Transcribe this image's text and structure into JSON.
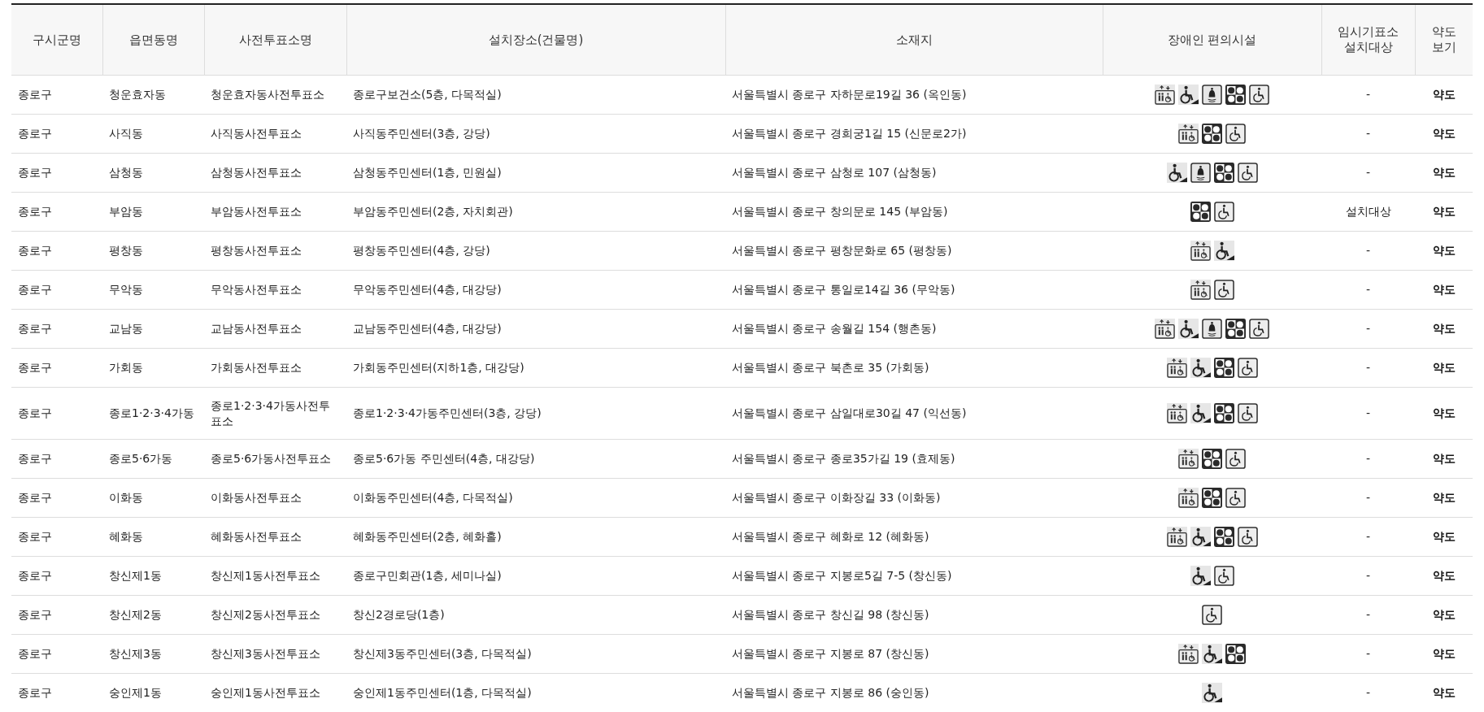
{
  "columns": [
    "구시군명",
    "읍면동명",
    "사전투표소명",
    "설치장소(건물명)",
    "소재지",
    "장애인 편의시설",
    "임시기표소 설치대상",
    "약도 보기"
  ],
  "rows": [
    {
      "district": "종로구",
      "dong": "청운효자동",
      "station": "청운효자동사전투표소",
      "place": "종로구보건소(5층, 다목적실)",
      "address": "서울특별시 종로구 자하문로19길 36 (옥인동)",
      "facilities": [
        {
          "kind": "elevator"
        },
        {
          "kind": "ramp"
        },
        {
          "kind": "bell"
        },
        {
          "kind": "braille"
        },
        {
          "kind": "wheelchair"
        }
      ],
      "temp_booth": "-",
      "map_link": "약도"
    },
    {
      "district": "종로구",
      "dong": "사직동",
      "station": "사직동사전투표소",
      "place": "사직동주민센터(3층, 강당)",
      "address": "서울특별시 종로구 경희궁1길 15 (신문로2가)",
      "facilities": [
        {
          "kind": "elevator"
        },
        {
          "kind": "braille"
        },
        {
          "kind": "wheelchair"
        }
      ],
      "temp_booth": "-",
      "map_link": "약도"
    },
    {
      "district": "종로구",
      "dong": "삼청동",
      "station": "삼청동사전투표소",
      "place": "삼청동주민센터(1층, 민원실)",
      "address": "서울특별시 종로구 삼청로 107 (삼청동)",
      "facilities": [
        {
          "kind": "ramp"
        },
        {
          "kind": "bell"
        },
        {
          "kind": "braille"
        },
        {
          "kind": "wheelchair"
        }
      ],
      "temp_booth": "-",
      "map_link": "약도"
    },
    {
      "district": "종로구",
      "dong": "부암동",
      "station": "부암동사전투표소",
      "place": "부암동주민센터(2층, 자치회관)",
      "address": "서울특별시 종로구 창의문로 145 (부암동)",
      "facilities": [
        {
          "kind": "braille"
        },
        {
          "kind": "wheelchair"
        }
      ],
      "temp_booth": "설치대상",
      "map_link": "약도"
    },
    {
      "district": "종로구",
      "dong": "평창동",
      "station": "평창동사전투표소",
      "place": "평창동주민센터(4층, 강당)",
      "address": "서울특별시 종로구 평창문화로 65 (평창동)",
      "facilities": [
        {
          "kind": "elevator"
        },
        {
          "kind": "ramp"
        }
      ],
      "temp_booth": "-",
      "map_link": "약도"
    },
    {
      "district": "종로구",
      "dong": "무악동",
      "station": "무악동사전투표소",
      "place": "무악동주민센터(4층, 대강당)",
      "address": "서울특별시 종로구 통일로14길 36 (무악동)",
      "facilities": [
        {
          "kind": "elevator"
        },
        {
          "kind": "wheelchair"
        }
      ],
      "temp_booth": "-",
      "map_link": "약도"
    },
    {
      "district": "종로구",
      "dong": "교남동",
      "station": "교남동사전투표소",
      "place": "교남동주민센터(4층, 대강당)",
      "address": "서울특별시 종로구 송월길 154 (행촌동)",
      "facilities": [
        {
          "kind": "elevator"
        },
        {
          "kind": "ramp"
        },
        {
          "kind": "bell"
        },
        {
          "kind": "braille"
        },
        {
          "kind": "wheelchair"
        }
      ],
      "temp_booth": "-",
      "map_link": "약도"
    },
    {
      "district": "종로구",
      "dong": "가회동",
      "station": "가회동사전투표소",
      "place": "가회동주민센터(지하1층, 대강당)",
      "address": "서울특별시 종로구 북촌로 35 (가회동)",
      "facilities": [
        {
          "kind": "elevator"
        },
        {
          "kind": "ramp"
        },
        {
          "kind": "braille"
        },
        {
          "kind": "wheelchair"
        }
      ],
      "temp_booth": "-",
      "map_link": "약도"
    },
    {
      "district": "종로구",
      "dong": "종로1·2·3·4가동",
      "station": "종로1·2·3·4가동사전투표소",
      "place": "종로1·2·3·4가동주민센터(3층, 강당)",
      "address": "서울특별시 종로구 삼일대로30길 47 (익선동)",
      "facilities": [
        {
          "kind": "elevator"
        },
        {
          "kind": "ramp"
        },
        {
          "kind": "braille"
        },
        {
          "kind": "wheelchair"
        }
      ],
      "temp_booth": "-",
      "map_link": "약도"
    },
    {
      "district": "종로구",
      "dong": "종로5·6가동",
      "station": "종로5·6가동사전투표소",
      "place": "종로5·6가동 주민센터(4층, 대강당)",
      "address": "서울특별시 종로구 종로35가길 19 (효제동)",
      "facilities": [
        {
          "kind": "elevator"
        },
        {
          "kind": "braille"
        },
        {
          "kind": "wheelchair"
        }
      ],
      "temp_booth": "-",
      "map_link": "약도"
    },
    {
      "district": "종로구",
      "dong": "이화동",
      "station": "이화동사전투표소",
      "place": "이화동주민센터(4층, 다목적실)",
      "address": "서울특별시 종로구 이화장길 33 (이화동)",
      "facilities": [
        {
          "kind": "elevator"
        },
        {
          "kind": "braille"
        },
        {
          "kind": "wheelchair"
        }
      ],
      "temp_booth": "-",
      "map_link": "약도"
    },
    {
      "district": "종로구",
      "dong": "혜화동",
      "station": "혜화동사전투표소",
      "place": "혜화동주민센터(2층, 혜화홀)",
      "address": "서울특별시 종로구 혜화로 12 (혜화동)",
      "facilities": [
        {
          "kind": "elevator"
        },
        {
          "kind": "ramp"
        },
        {
          "kind": "braille"
        },
        {
          "kind": "wheelchair"
        }
      ],
      "temp_booth": "-",
      "map_link": "약도"
    },
    {
      "district": "종로구",
      "dong": "창신제1동",
      "station": "창신제1동사전투표소",
      "place": "종로구민회관(1층, 세미나실)",
      "address": "서울특별시 종로구 지봉로5길 7-5 (창신동)",
      "facilities": [
        {
          "kind": "ramp"
        },
        {
          "kind": "wheelchair"
        }
      ],
      "temp_booth": "-",
      "map_link": "약도"
    },
    {
      "district": "종로구",
      "dong": "창신제2동",
      "station": "창신제2동사전투표소",
      "place": "창신2경로당(1층)",
      "address": "서울특별시 종로구 창신길 98 (창신동)",
      "facilities": [
        {
          "kind": "wheelchair"
        }
      ],
      "temp_booth": "-",
      "map_link": "약도"
    },
    {
      "district": "종로구",
      "dong": "창신제3동",
      "station": "창신제3동사전투표소",
      "place": "창신제3동주민센터(3층, 다목적실)",
      "address": "서울특별시 종로구 지봉로 87 (창신동)",
      "facilities": [
        {
          "kind": "elevator"
        },
        {
          "kind": "ramp"
        },
        {
          "kind": "braille"
        }
      ],
      "temp_booth": "-",
      "map_link": "약도"
    },
    {
      "district": "종로구",
      "dong": "숭인제1동",
      "station": "숭인제1동사전투표소",
      "place": "숭인제1동주민센터(1층, 다목적실)",
      "address": "서울특별시 종로구 지봉로 86 (숭인동)",
      "facilities": [
        {
          "kind": "ramp"
        }
      ],
      "temp_booth": "-",
      "map_link": "약도"
    }
  ]
}
